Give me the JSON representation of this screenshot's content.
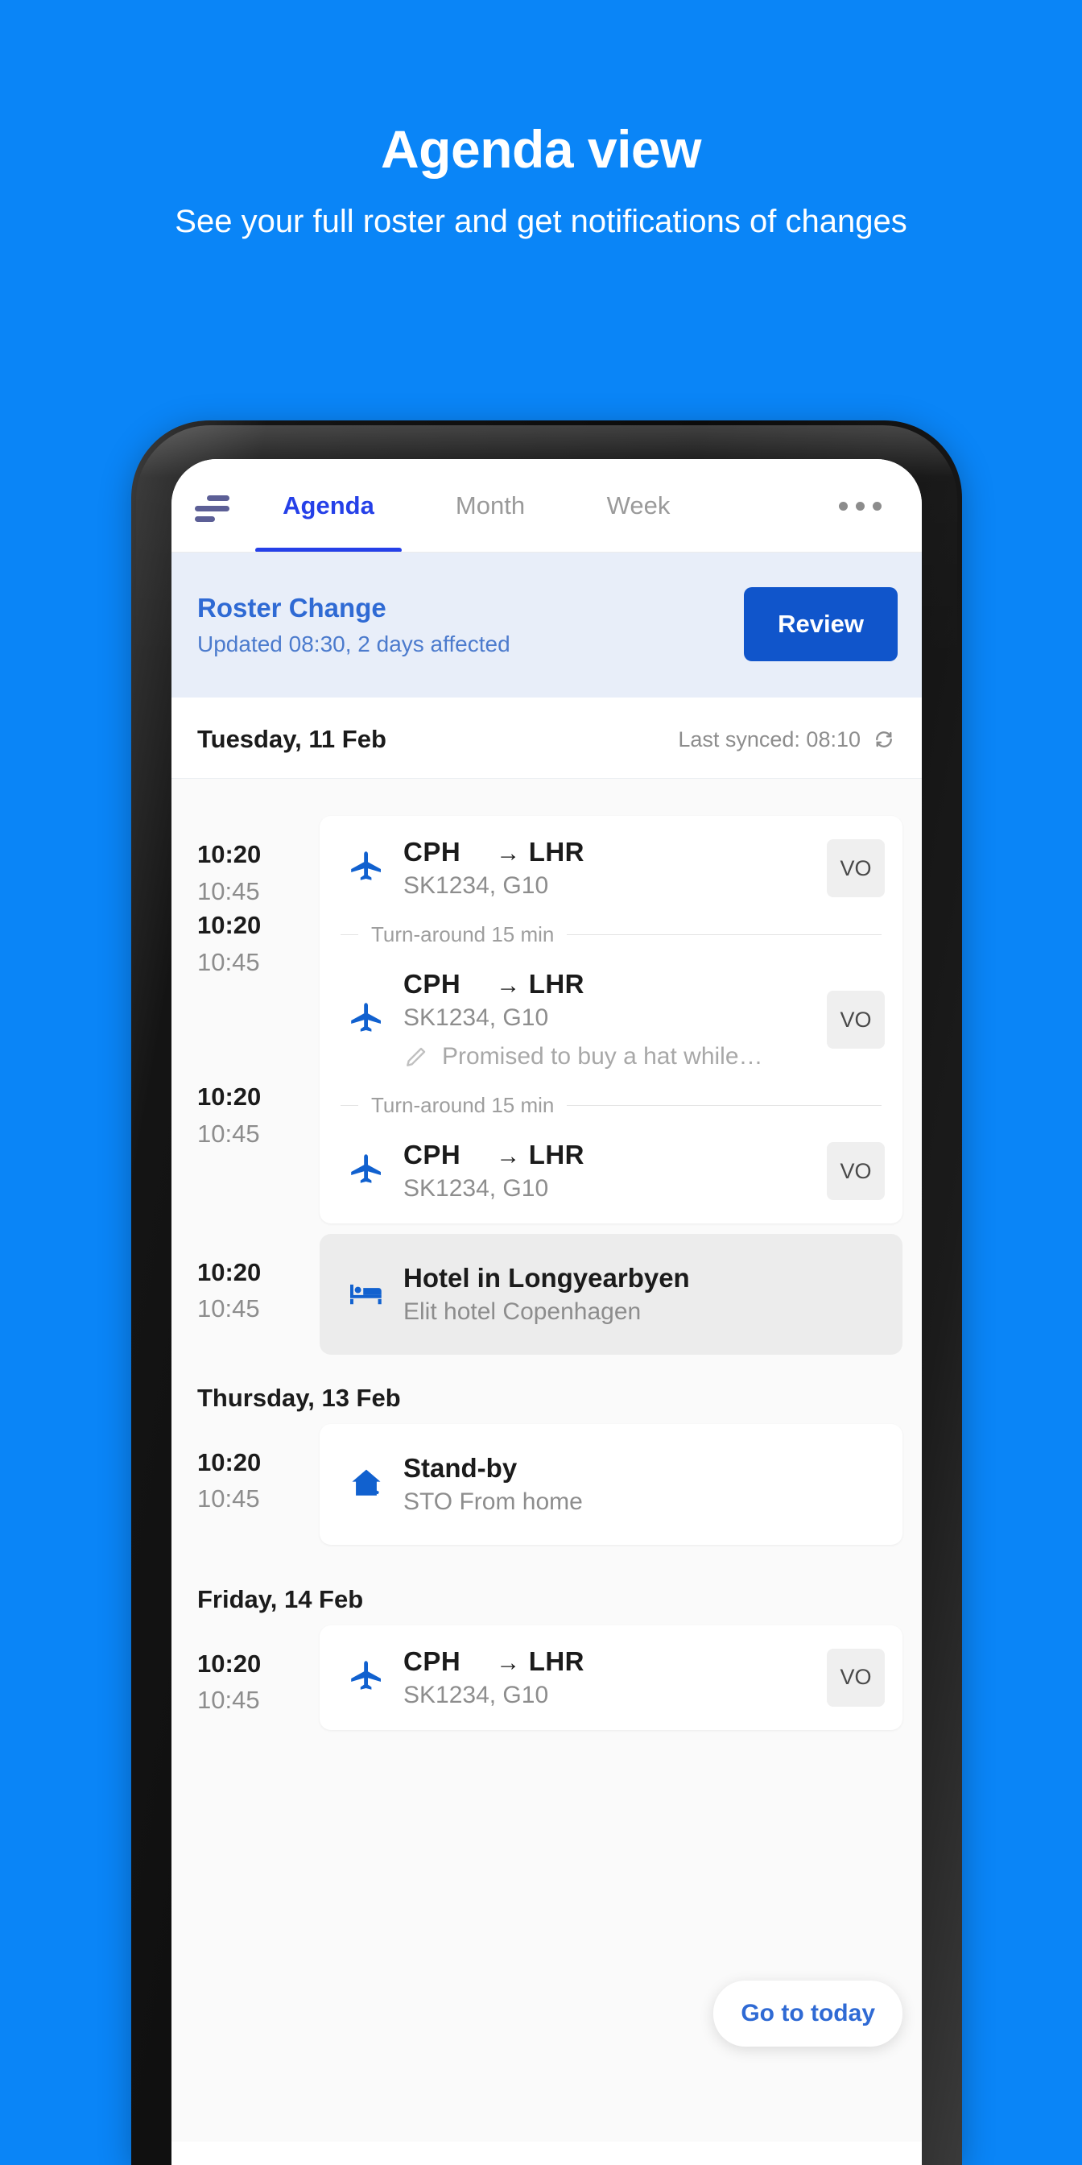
{
  "promo": {
    "title": "Agenda view",
    "subtitle": "See your full roster and get notifications of changes"
  },
  "colors": {
    "background": "#0a85f7",
    "accent_blue": "#1055cb",
    "tab_active": "#2540e8",
    "banner_bg": "#e8eef9",
    "banner_title": "#2f6ad4",
    "icon_blue": "#1161cf"
  },
  "tabbar": {
    "sort_icon": "sort-icon",
    "tabs": [
      {
        "label": "Agenda",
        "active": true
      },
      {
        "label": "Month",
        "active": false
      },
      {
        "label": "Week",
        "active": false
      }
    ],
    "overflow_icon": "ellipsis-icon"
  },
  "banner": {
    "title": "Roster Change",
    "subtitle": "Updated 08:30, 2 days affected",
    "button_label": "Review"
  },
  "day_header": {
    "label": "Tuesday, 11 Feb",
    "sync_text": "Last synced: 08:10",
    "sync_icon": "refresh-icon"
  },
  "agenda": {
    "go_to_today_label": "Go to today",
    "turnaround_label": "Turn-around 15 min",
    "sections": [
      {
        "date_label": "",
        "groups": [
          {
            "times": {
              "start": "10:20",
              "end": "10:45"
            },
            "events": [
              {
                "type": "flight",
                "icon": "airplane-icon",
                "origin": "CPH",
                "arrow": "→",
                "destination": "LHR",
                "detail": "SK1234, G10",
                "badge": "VO",
                "note": null
              }
            ]
          },
          {
            "times": {
              "start": "10:20",
              "end": "10:45"
            },
            "events": [
              {
                "type": "flight",
                "icon": "airplane-icon",
                "origin": "CPH",
                "arrow": "→",
                "destination": "LHR",
                "detail": "SK1234, G10",
                "badge": "VO",
                "note": "Promised to buy a hat while…",
                "note_icon": "pencil-icon"
              }
            ]
          },
          {
            "times": {
              "start": "10:20",
              "end": "10:45"
            },
            "events": [
              {
                "type": "flight",
                "icon": "airplane-icon",
                "origin": "CPH",
                "arrow": "→",
                "destination": "LHR",
                "detail": "SK1234, G10",
                "badge": "VO",
                "note": null
              }
            ]
          },
          {
            "times": {
              "start": "10:20",
              "end": "10:45"
            },
            "events": [
              {
                "type": "hotel",
                "icon": "bed-icon",
                "title": "Hotel in Longyearbyen",
                "detail": "Elit hotel Copenhagen"
              }
            ]
          }
        ]
      },
      {
        "date_label": "Thursday, 13 Feb",
        "groups": [
          {
            "times": {
              "start": "10:20",
              "end": "10:45"
            },
            "events": [
              {
                "type": "standby",
                "icon": "home-phone-icon",
                "title": "Stand-by",
                "detail": "STO From home"
              }
            ]
          }
        ]
      },
      {
        "date_label": "Friday, 14 Feb",
        "groups": [
          {
            "times": {
              "start": "10:20",
              "end": "10:45"
            },
            "events": [
              {
                "type": "flight",
                "icon": "airplane-icon",
                "origin": "CPH",
                "arrow": "→",
                "destination": "LHR",
                "detail": "SK1234, G10",
                "badge": "VO",
                "note": null
              }
            ]
          }
        ]
      }
    ]
  }
}
